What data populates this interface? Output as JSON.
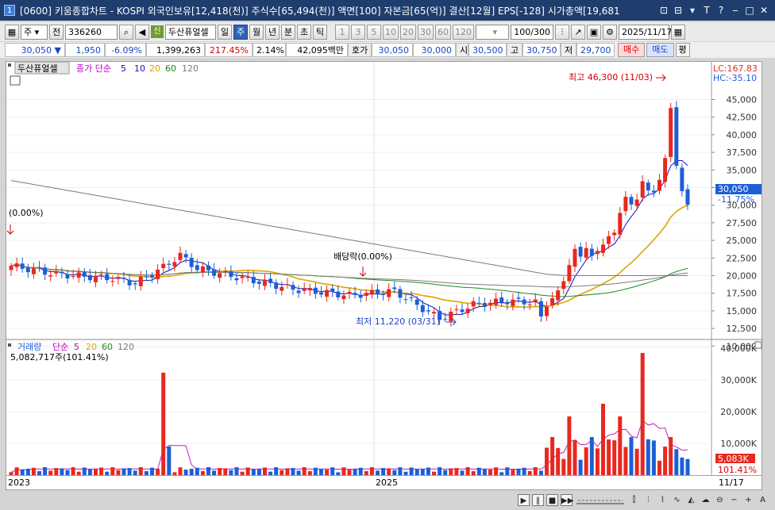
{
  "window": {
    "number": "1",
    "title": "[0600] 키움종합차트 - KOSPI 외국인보유[12,418(천)] 주식수[65,494(천)] 액면[100] 자본금[65(억)] 결산[12월] EPS[-128] 시가총액[19,681",
    "buttons": [
      "⊡",
      "⊟",
      "▾",
      "T",
      "?",
      "‒",
      "□",
      "✕"
    ]
  },
  "toolbar": {
    "period_select": "주",
    "prev_label": "전",
    "code": "336260",
    "company_name": "두산퓨얼셀",
    "period_tabs": [
      "일",
      "주",
      "월",
      "년",
      "분",
      "초",
      "틱"
    ],
    "active_period": "주",
    "intervals": [
      "1",
      "3",
      "5",
      "10",
      "20",
      "30",
      "60",
      "120"
    ],
    "count": "100/300",
    "date": "2025/11/17",
    "green_icon": "신"
  },
  "quote": {
    "price": "30,050",
    "direction": "▼",
    "change": "1,950",
    "change_pct": "-6.09%",
    "volume": "1,399,263",
    "volume_ratio": "217.45%",
    "turnover": "2.14%",
    "amount": "42,095백만",
    "hoga_label": "호가",
    "bid": "30,050",
    "ask": "30,000",
    "open_label": "시",
    "open": "30,500",
    "high_label": "고",
    "high": "30,750",
    "low_label": "저",
    "low": "29,700",
    "buy_button": "매수",
    "sell_button": "매도",
    "eval_button": "평"
  },
  "price_panel": {
    "stock_label": "두산퓨얼셀",
    "legend_prefix": "종가 단순",
    "ma_periods": [
      "5",
      "10",
      "20",
      "60",
      "120"
    ],
    "ma_colors": [
      "#1010c8",
      "#1010c8",
      "#e1a300",
      "#1a8a1a",
      "#7a7a7a"
    ],
    "lc_label": "LC:167.83",
    "hc_label": "HC:-35.10",
    "high_annotation": "최고 46,300 (11/03)",
    "low_annotation": "최저 11,220 (03/31)",
    "dividend_annotation": "배당락(0.00%)",
    "left_annotation": "(0.00%)",
    "current_price_label": "30,050",
    "current_pct_label": "-11.75%",
    "y_ticks": [
      "45,000",
      "42,500",
      "40,000",
      "37,500",
      "35,000",
      "32,500",
      "30,000",
      "27,500",
      "25,000",
      "22,500",
      "20,000",
      "17,500",
      "15,000",
      "12,500",
      "10,000"
    ]
  },
  "volume_panel": {
    "legend_label": "거래량",
    "legend_prefix": "단순",
    "ma_periods": [
      "5",
      "20",
      "60",
      "120"
    ],
    "current_text": "5,082,717주(101.41%)",
    "y_ticks": [
      "40,000K",
      "30,000K",
      "20,000K",
      "10,000K"
    ],
    "current_volume_label": "5,083K",
    "current_ratio_label": "101.41%"
  },
  "x_axis": {
    "labels": [
      "2023",
      "2025"
    ],
    "right_label": "11/17"
  },
  "colors": {
    "up": "#e8281e",
    "down": "#1c5fd6",
    "ma5": "#1010c8",
    "ma20": "#e1a300",
    "ma60": "#1a8a1a",
    "ma120": "#7a7a7a",
    "vol_ma5": "#c020c0"
  }
}
